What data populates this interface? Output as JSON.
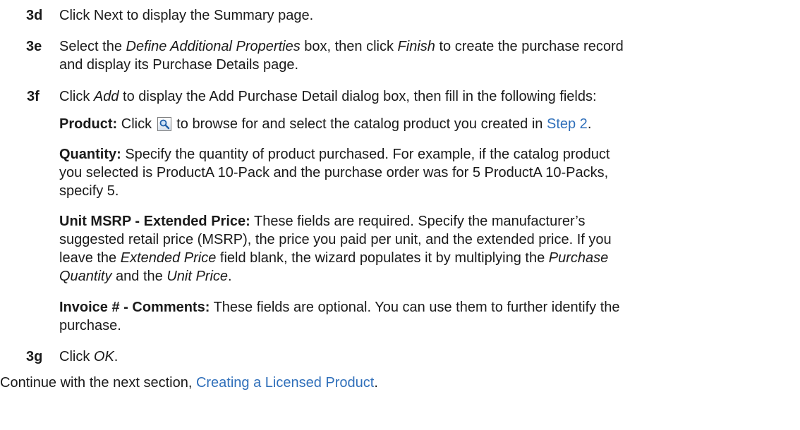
{
  "steps": {
    "s3d": {
      "num": "3d",
      "text": "Click Next to display the Summary page."
    },
    "s3e": {
      "num": "3e",
      "pre": "Select the ",
      "em1": "Define Additional Properties",
      "mid": " box, then click ",
      "em2": "Finish",
      "post1": " to create the purchase record",
      "line2": "and display its Purchase Details page."
    },
    "s3f": {
      "num": "3f",
      "pre": "Click ",
      "em": "Add",
      "post": " to display the Add Purchase Detail dialog box, then fill in the following fields:"
    },
    "s3g": {
      "num": "3g",
      "pre": "Click ",
      "em": "OK",
      "post": "."
    }
  },
  "fields": {
    "product": {
      "label": "Product:",
      "pre": " Click ",
      "icon": "search-icon",
      "mid": " to browse for and select the catalog product you created in ",
      "link": "Step 2",
      "post": "."
    },
    "quantity": {
      "label": "Quantity:",
      "line1": " Specify the quantity of product purchased. For example, if the catalog product",
      "line2": "you selected is ProductA 10-Pack and the purchase order was for 5 ProductA 10-Packs,",
      "line3": "specify 5."
    },
    "unit": {
      "label": "Unit MSRP - Extended Price:",
      "line1": " These fields are required. Specify the manufacturer’s",
      "line2": "suggested retail price (MSRP), the price you paid per unit, and the extended price. If you",
      "line3a": "leave the ",
      "line3em": "Extended Price",
      "line3b": " field blank, the wizard populates it by multiplying the ",
      "line3em2": "Purchase",
      "line4em": "Quantity",
      "line4a": " and the ",
      "line4em2": "Unit Price",
      "line4b": "."
    },
    "invoice": {
      "label": "Invoice # - Comments:",
      "line1": " These fields are optional. You can use them to further identify the",
      "line2": "purchase."
    }
  },
  "continue": {
    "pre": "Continue with the next section, ",
    "link": "Creating a Licensed Product",
    "post": "."
  },
  "colors": {
    "link": "#2f6fba",
    "text": "#1a1a1a"
  }
}
